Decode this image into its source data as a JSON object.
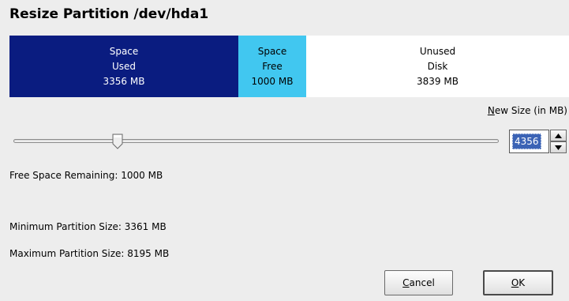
{
  "dialog": {
    "title": "Resize Partition /dev/hda1"
  },
  "partition_bar": {
    "used": {
      "line1": "Space",
      "line2": "Used",
      "line3": "3356 MB",
      "color": "#0a1c80"
    },
    "free": {
      "line1": "Space",
      "line2": "Free",
      "line3": "1000 MB",
      "color": "#41c7f0"
    },
    "unused": {
      "line1": "Unused",
      "line2": "Disk",
      "line3": "3839 MB",
      "color": "#ffffff"
    }
  },
  "new_size": {
    "label_mnemonic": "N",
    "label_rest": "ew Size (in MB)",
    "value": "4356",
    "slider_fraction": 0.215
  },
  "info": {
    "free_remaining": "Free Space Remaining: 1000 MB",
    "min_size": "Minimum Partition Size: 3361 MB",
    "max_size": "Maximum Partition Size: 8195 MB"
  },
  "buttons": {
    "cancel": {
      "mnemonic": "C",
      "rest": "ancel"
    },
    "ok": {
      "mnemonic": "O",
      "rest": "K"
    }
  }
}
